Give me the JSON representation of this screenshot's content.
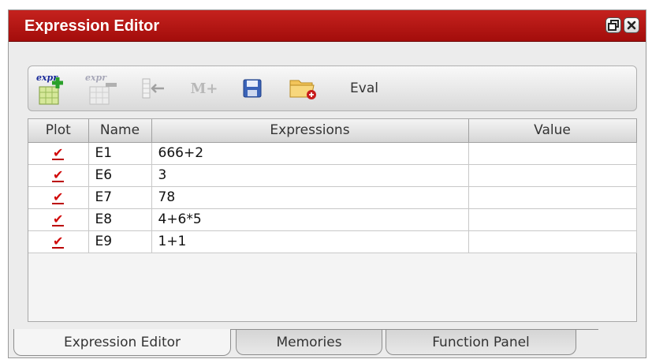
{
  "window": {
    "title": "Expression Editor",
    "buttons": {
      "restore_icon": "restore-icon",
      "close_icon": "close-icon"
    }
  },
  "toolbar": {
    "expr_add_label": "expr",
    "expr_remove_label": "expr",
    "mplus_label": "M+",
    "eval_label": "Eval"
  },
  "table": {
    "headers": [
      "Plot",
      "Name",
      "Expressions",
      "Value"
    ],
    "rows": [
      {
        "plot": "✔",
        "name": "E1",
        "expression": "666+2",
        "value": ""
      },
      {
        "plot": "✔",
        "name": "E6",
        "expression": "3",
        "value": ""
      },
      {
        "plot": "✔",
        "name": "E7",
        "expression": "78",
        "value": ""
      },
      {
        "plot": "✔",
        "name": "E8",
        "expression": "4+6*5",
        "value": ""
      },
      {
        "plot": "✔",
        "name": "E9",
        "expression": "1+1",
        "value": ""
      }
    ]
  },
  "tabs": [
    {
      "label": "Expression Editor",
      "active": true
    },
    {
      "label": "Memories",
      "active": false
    },
    {
      "label": "Function Panel",
      "active": false
    }
  ],
  "colors": {
    "titlebar": "#b51714",
    "check": "#d10b0b"
  }
}
